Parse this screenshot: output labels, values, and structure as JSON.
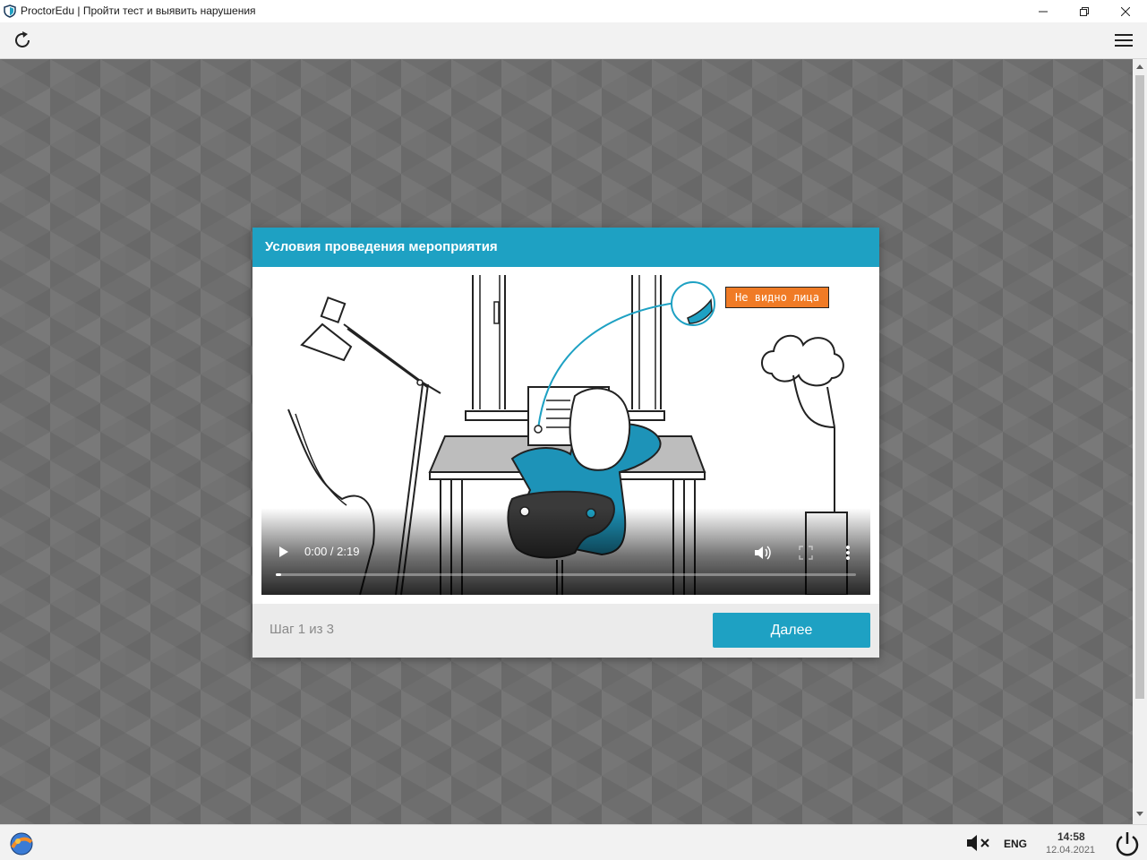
{
  "window": {
    "title": "ProctorEdu | Пройти тест и выявить нарушения",
    "icon": "shield-icon"
  },
  "toolbar": {
    "reload_icon": "reload-icon",
    "menu_icon": "hamburger-menu-icon"
  },
  "dialog": {
    "title": "Условия проведения мероприятия",
    "video": {
      "time": "0:00 / 2:19",
      "progress": 0.01,
      "overlay_tag": "Не видно лица"
    },
    "step": "Шаг 1 из 3",
    "next_label": "Далее"
  },
  "taskbar": {
    "language": "ENG",
    "time": "14:58",
    "date": "12.04.2021"
  },
  "colors": {
    "accent": "#1ea1c3",
    "background": "#6e6e6e",
    "tag": "#f07b26"
  }
}
